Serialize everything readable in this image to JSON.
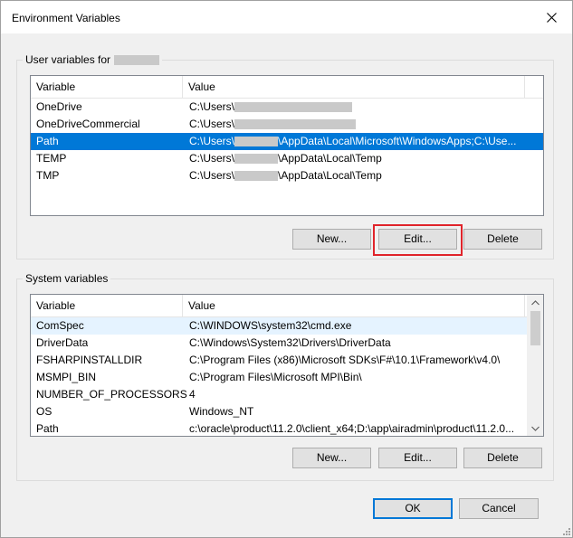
{
  "window": {
    "title": "Environment Variables"
  },
  "user_section": {
    "legend": "User variables for",
    "columns": [
      "Variable",
      "Value"
    ],
    "rows": [
      {
        "variable": "OneDrive",
        "value_prefix": "C:\\Users\\",
        "value_suffix": ""
      },
      {
        "variable": "OneDriveCommercial",
        "value_prefix": "C:\\Users\\",
        "value_suffix": ""
      },
      {
        "variable": "Path",
        "value_prefix": "C:\\Users\\",
        "value_suffix": "\\AppData\\Local\\Microsoft\\WindowsApps;C:\\Use..."
      },
      {
        "variable": "TEMP",
        "value_prefix": "C:\\Users\\",
        "value_suffix": "\\AppData\\Local\\Temp"
      },
      {
        "variable": "TMP",
        "value_prefix": "C:\\Users\\",
        "value_suffix": "\\AppData\\Local\\Temp"
      }
    ],
    "buttons": {
      "new": "New...",
      "edit": "Edit...",
      "delete": "Delete"
    }
  },
  "system_section": {
    "legend": "System variables",
    "columns": [
      "Variable",
      "Value"
    ],
    "rows": [
      {
        "variable": "ComSpec",
        "value": "C:\\WINDOWS\\system32\\cmd.exe"
      },
      {
        "variable": "DriverData",
        "value": "C:\\Windows\\System32\\Drivers\\DriverData"
      },
      {
        "variable": "FSHARPINSTALLDIR",
        "value": "C:\\Program Files (x86)\\Microsoft SDKs\\F#\\10.1\\Framework\\v4.0\\"
      },
      {
        "variable": "MSMPI_BIN",
        "value": "C:\\Program Files\\Microsoft MPI\\Bin\\"
      },
      {
        "variable": "NUMBER_OF_PROCESSORS",
        "value": "4"
      },
      {
        "variable": "OS",
        "value": "Windows_NT"
      },
      {
        "variable": "Path",
        "value": "c:\\oracle\\product\\11.2.0\\client_x64;D:\\app\\airadmin\\product\\11.2.0..."
      }
    ],
    "buttons": {
      "new": "New...",
      "edit": "Edit...",
      "delete": "Delete"
    }
  },
  "footer": {
    "ok": "OK",
    "cancel": "Cancel"
  },
  "colors": {
    "selection": "#0078d7",
    "highlight_box": "#e0242b",
    "accent": "#0078d7"
  },
  "icons": {
    "close": "close-icon",
    "scroll_up": "chevron-up-icon",
    "scroll_down": "chevron-down-icon",
    "grip": "resize-grip-icon"
  }
}
